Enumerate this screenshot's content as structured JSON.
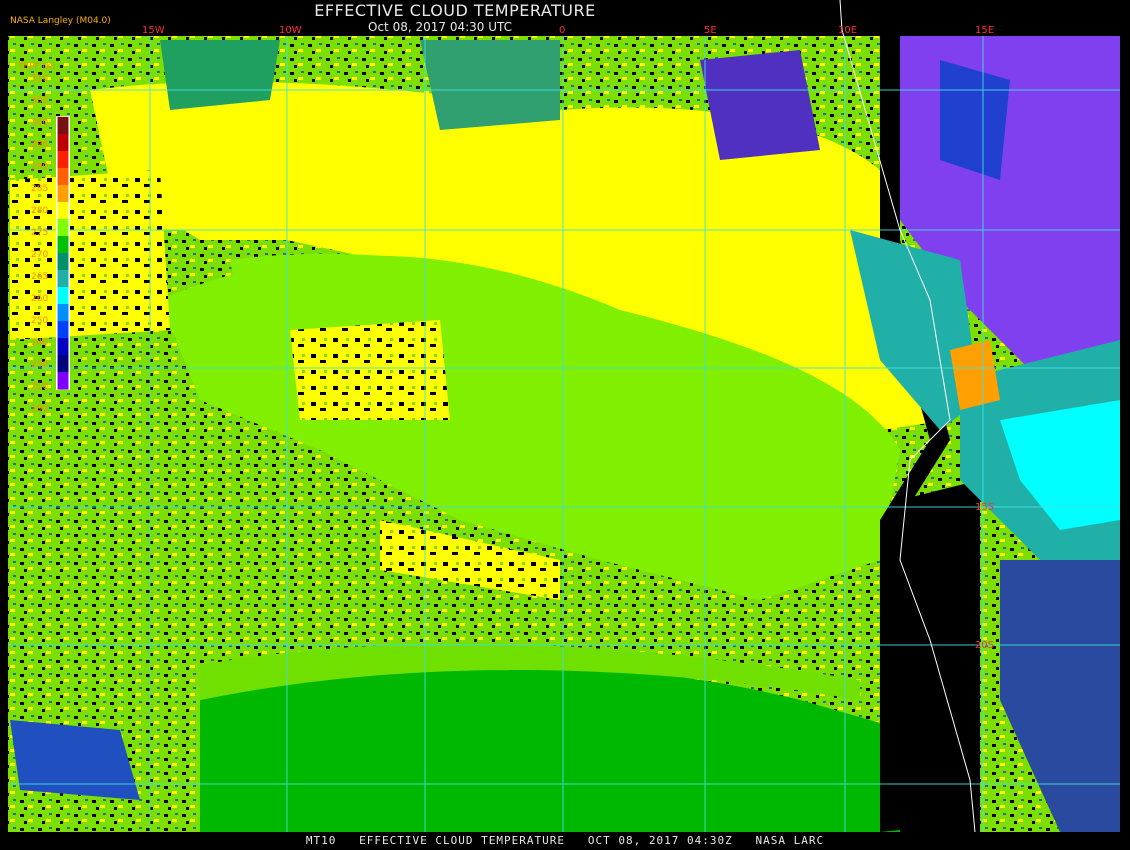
{
  "title": "EFFECTIVE CLOUD TEMPERATURE",
  "subtitle": "Oct 08, 2017 04:30 UTC",
  "brand": "NASA Langley (M04.0)",
  "footer": "MT10   EFFECTIVE CLOUD TEMPERATURE   OCT 08, 2017 04:30Z   NASA LARC",
  "legend": {
    "label": "TEFF (K)",
    "ticks": [
      "310",
      "305",
      "300",
      "295",
      "290",
      "285",
      "280",
      "275",
      "270",
      "265",
      "260",
      "250",
      "240",
      "230",
      "210",
      "190"
    ],
    "colors": [
      "#7a1010",
      "#c00000",
      "#ff2000",
      "#ff6000",
      "#ffa000",
      "#ffff00",
      "#80ff00",
      "#00c000",
      "#00906a",
      "#20b0a8",
      "#00ffff",
      "#0090ff",
      "#0040ff",
      "#0000c0",
      "#000080",
      "#8000ff"
    ]
  },
  "grid": {
    "lon_labels": [
      "15W",
      "10W",
      "0",
      "5E",
      "10E",
      "15E"
    ],
    "lat_labels": [
      "15S",
      "20S"
    ]
  }
}
